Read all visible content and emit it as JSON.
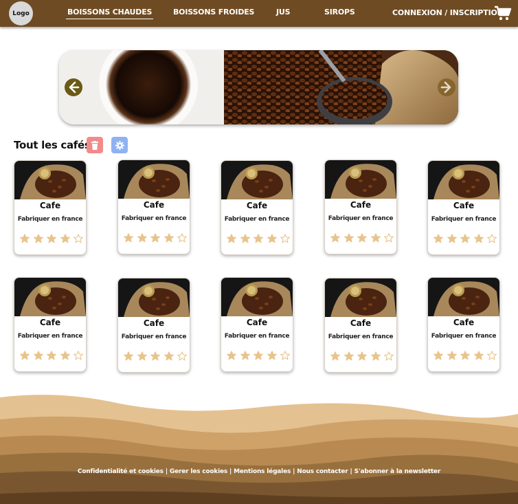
{
  "header": {
    "logo_label": "Logo",
    "nav": [
      {
        "label": "BOISSONS CHAUDES",
        "active": true
      },
      {
        "label": "BOISSONS FROIDES",
        "active": false
      },
      {
        "label": "JUS",
        "active": false
      },
      {
        "label": "SIROPS",
        "active": false
      }
    ],
    "login_label": "CONNEXION / INSCRIPTION",
    "cart_icon": "cart-icon"
  },
  "carousel": {
    "prev_icon": "arrow-left-icon",
    "next_icon": "arrow-right-icon"
  },
  "section": {
    "title": "Tout les cafés",
    "delete_icon": "trash-icon",
    "settings_icon": "gear-icon"
  },
  "products": [
    {
      "name": "Cafe",
      "origin": "Fabriquer en france",
      "rating": 4
    },
    {
      "name": "Cafe",
      "origin": "Fabriquer en france",
      "rating": 4
    },
    {
      "name": "Cafe",
      "origin": "Fabriquer en france",
      "rating": 4
    },
    {
      "name": "Cafe",
      "origin": "Fabriquer en france",
      "rating": 4
    },
    {
      "name": "Cafe",
      "origin": "Fabriquer en france",
      "rating": 4
    },
    {
      "name": "Cafe",
      "origin": "Fabriquer en france",
      "rating": 4
    },
    {
      "name": "Cafe",
      "origin": "Fabriquer en france",
      "rating": 4
    },
    {
      "name": "Cafe",
      "origin": "Fabriquer en france",
      "rating": 4
    },
    {
      "name": "Cafe",
      "origin": "Fabriquer en france",
      "rating": 4
    },
    {
      "name": "Cafe",
      "origin": "Fabriquer en france",
      "rating": 4
    }
  ],
  "rating_max": 5,
  "footer": {
    "links": [
      "Confidentialité et cookies",
      "Gerer les cookies",
      "Mentions légales",
      "Nous contacter",
      "S'abonner à la newsletter"
    ]
  },
  "colors": {
    "nav_bg": "#6e4b22",
    "star": "#e8c48c",
    "delete_btn": "#f28a8a",
    "settings_btn": "#8fb2f2"
  }
}
